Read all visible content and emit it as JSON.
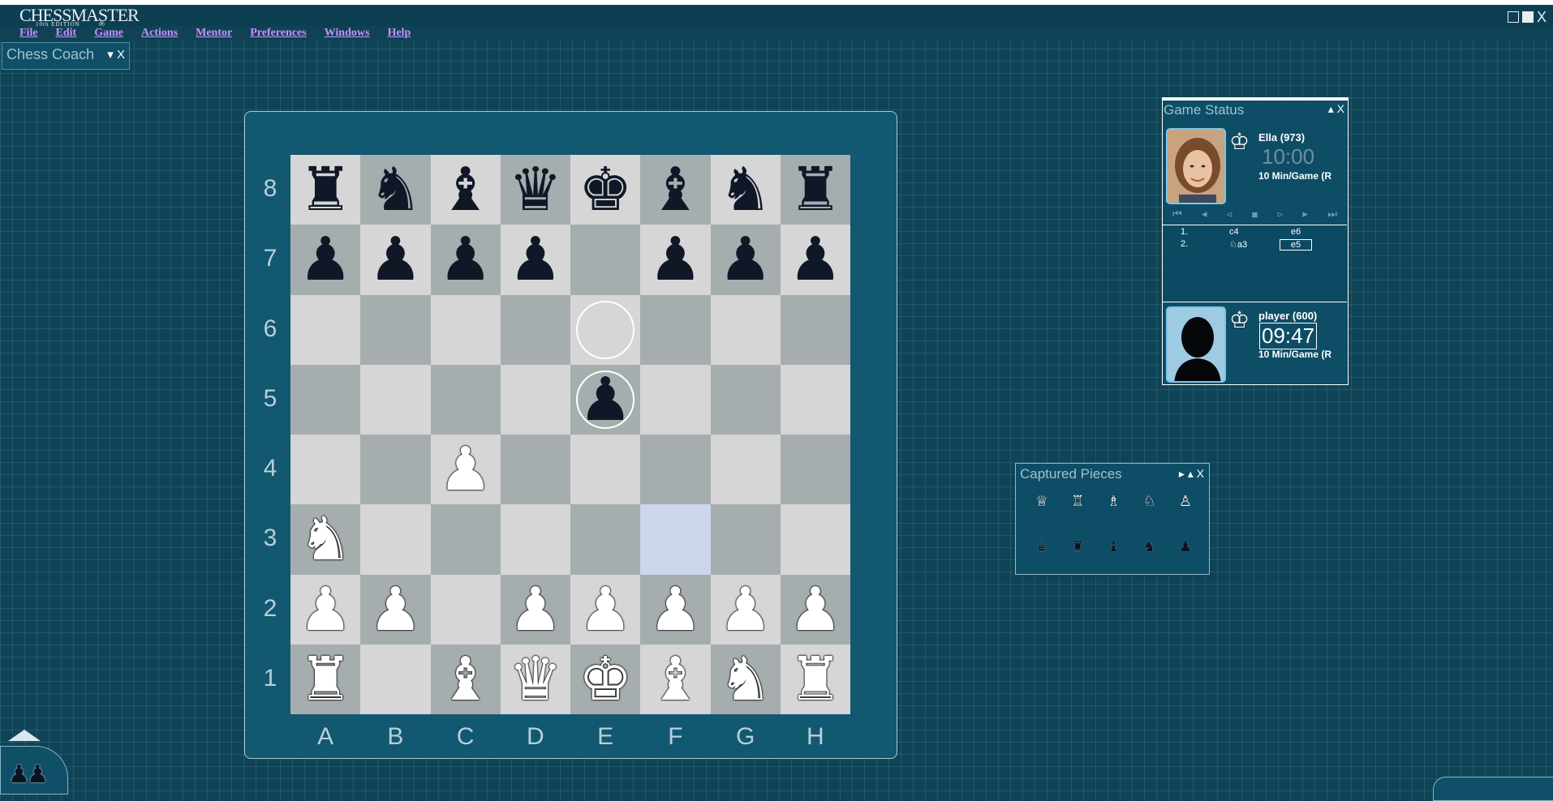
{
  "app": {
    "logo_text": "CHESSMASTER",
    "logo_sub": "10th EDITION",
    "logo_mark": "®",
    "close_glyph": "X"
  },
  "menu": {
    "items": [
      "File",
      "Edit",
      "Game",
      "Actions",
      "Mentor",
      "Preferences",
      "Windows",
      "Help"
    ]
  },
  "coach": {
    "title": "Chess Coach",
    "controls": "▾ X"
  },
  "board": {
    "ranks": [
      "8",
      "7",
      "6",
      "5",
      "4",
      "3",
      "2",
      "1"
    ],
    "files": [
      "A",
      "B",
      "C",
      "D",
      "E",
      "F",
      "G",
      "H"
    ],
    "rows": [
      [
        "bR",
        "bN",
        "bB",
        "bQ",
        "bK",
        "bB",
        "bN",
        "bR"
      ],
      [
        "bP",
        "bP",
        "bP",
        "bP",
        "",
        "bP",
        "bP",
        "bP"
      ],
      [
        "",
        "",
        "",
        "",
        "",
        "",
        "",
        ""
      ],
      [
        "",
        "",
        "",
        "",
        "bP",
        "",
        "",
        ""
      ],
      [
        "",
        "",
        "wP",
        "",
        "",
        "",
        "",
        ""
      ],
      [
        "wN",
        "",
        "",
        "",
        "",
        "",
        "",
        ""
      ],
      [
        "wP",
        "wP",
        "",
        "wP",
        "wP",
        "wP",
        "wP",
        "wP"
      ],
      [
        "wR",
        "",
        "wB",
        "wQ",
        "wK",
        "wB",
        "wN",
        "wR"
      ]
    ],
    "last_move_from": "e6",
    "last_move_to": "e5",
    "highlight": "f3"
  },
  "status": {
    "title": "Game Status",
    "controls": "▴ X",
    "opponent": {
      "name": "Ella (973)",
      "clock": "10:00",
      "time_control": "10 Min/Game (R"
    },
    "player": {
      "name": "player (600)",
      "clock": "09:47",
      "time_control": "10 Min/Game (R"
    },
    "nav": [
      "⏮",
      "◂",
      "◃",
      "■",
      "▹",
      "▸",
      "⏭"
    ],
    "moves": [
      {
        "num": "1.",
        "white": "c4",
        "black": "e6"
      },
      {
        "num": "2.",
        "white": "♘a3",
        "black": "e5"
      }
    ]
  },
  "captured": {
    "title": "Captured Pieces",
    "controls": "▸ ▴ X",
    "white_row": [
      "♕",
      "♖",
      "♗",
      "♘",
      "♙"
    ],
    "black_row": [
      "♛",
      "♜",
      "♝",
      "♞",
      "♟"
    ]
  },
  "colors": {
    "background": "#0f4456",
    "board_light": "#d6d6d6",
    "board_dark": "#a6adae",
    "highlight": "#cdd6ea",
    "menu_text": "#c890ff"
  }
}
